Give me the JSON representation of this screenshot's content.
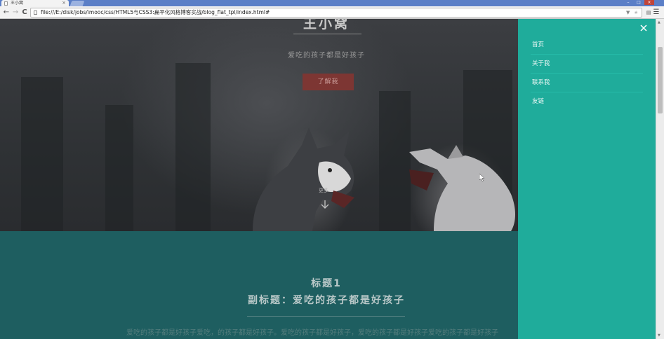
{
  "browser": {
    "tab_title": "王小窝",
    "tab_close": "×",
    "url": "file:///E:/disk/jobs/imooc/css/HTML5与CSS3:扁平化风格博客实战/blog_flat_tpl/index.html#",
    "nav_back": "←",
    "nav_forward": "→",
    "nav_reload": "C",
    "window_controls": [
      "–",
      "□",
      "×"
    ]
  },
  "hero": {
    "site_title": "王小窝",
    "tagline": "爱吃的孩子都是好孩子",
    "about_button": "了解我",
    "more_label": "更多"
  },
  "content": {
    "title": "标题1",
    "subtitle": "副标题：爱吃的孩子都是好孩子",
    "body": "爱吃的孩子都是好孩子爱吃，的孩子都是好孩子。爱吃的孩子都是好孩子，爱吃的孩子都是好孩子爱吃的孩子都是好孩子"
  },
  "side_menu": {
    "close": "×",
    "items": [
      {
        "label": "首页"
      },
      {
        "label": "关于我"
      },
      {
        "label": "联系我"
      },
      {
        "label": "友链"
      }
    ]
  },
  "colors": {
    "menu_bg": "#1fac9b",
    "content_bg": "#1e5e60",
    "button_bg": "#7d3633"
  }
}
